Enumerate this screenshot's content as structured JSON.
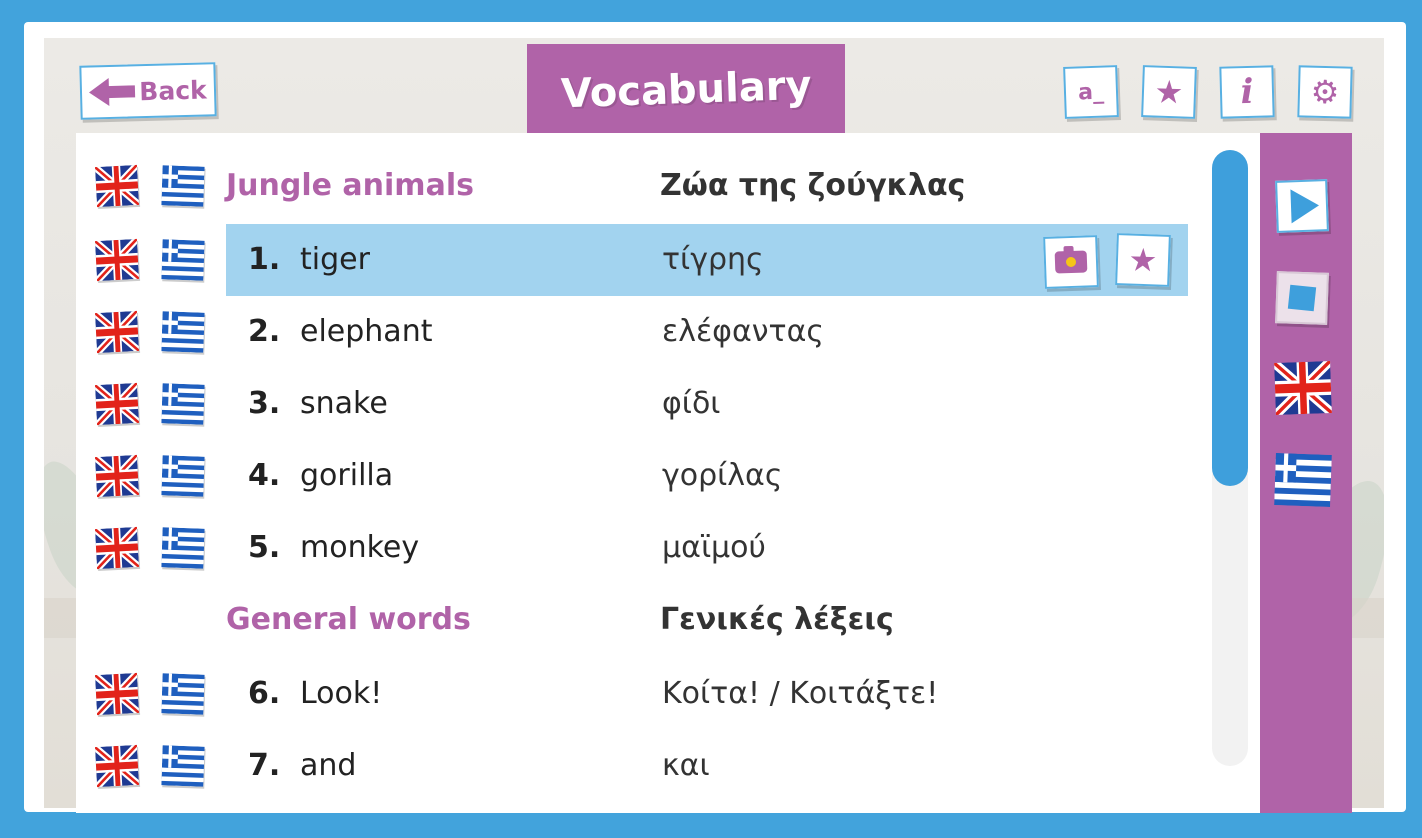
{
  "header": {
    "back_label": "Back",
    "title": "Vocabulary",
    "tools": [
      {
        "icon": "letter-a-icon",
        "label": "a_"
      },
      {
        "icon": "star-icon",
        "label": "★"
      },
      {
        "icon": "info-icon",
        "label": "i"
      },
      {
        "icon": "gear-icon",
        "label": "⚙"
      }
    ]
  },
  "categories": [
    {
      "en": "Jungle animals",
      "gr": "Ζώα της ζούγκλας"
    },
    {
      "en": "General words",
      "gr": "Γενικές λέξεις"
    }
  ],
  "words": [
    {
      "num": "1.",
      "en": "tiger",
      "gr": "τίγρης",
      "selected": true
    },
    {
      "num": "2.",
      "en": "elephant",
      "gr": "ελέφαντας"
    },
    {
      "num": "3.",
      "en": "snake",
      "gr": "φίδι"
    },
    {
      "num": "4.",
      "en": "gorilla",
      "gr": "γορίλας"
    },
    {
      "num": "5.",
      "en": "monkey",
      "gr": "μαϊμού"
    },
    {
      "num": "6.",
      "en": "Look!",
      "gr": "Κοίτα! / Κοιτάξτε!"
    },
    {
      "num": "7.",
      "en": "and",
      "gr": "και"
    }
  ],
  "colors": {
    "background": "#42a3dc",
    "accent": "#b063a8",
    "highlight": "#a2d3ef",
    "button_border": "#58b0e2"
  }
}
